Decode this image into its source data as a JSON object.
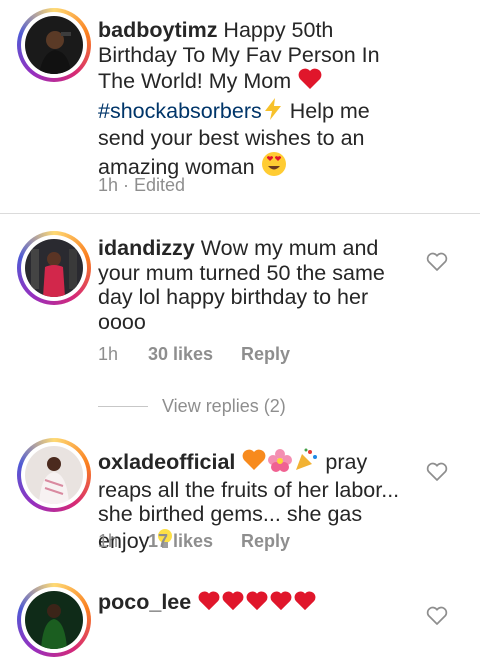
{
  "caption": {
    "username": "badboytimz",
    "text_1": " Happy 50th Birthday To My Fav Person In The World! My Mom ",
    "hashtag": "#shockabsorbers",
    "text_2": " Help me send your best wishes to an amazing woman ",
    "time": "1h",
    "separator": " · ",
    "edited": "Edited"
  },
  "comments": [
    {
      "username": "idandizzy",
      "text": " Wow my mum and your mum turned 50 the same day lol happy birthday to her oooo",
      "time": "1h",
      "likes": "30 likes",
      "reply": "Reply",
      "view_replies": "View replies (2)"
    },
    {
      "username": "oxladeofficial",
      "text": " pray reaps all the fruits of her labor... she birthed gems... she gas enjoy ",
      "time": "1h",
      "likes": "17 likes",
      "reply": "Reply"
    },
    {
      "username": "poco_lee",
      "text": ""
    }
  ],
  "colors": {
    "hashtag": "#003569",
    "meta": "#8e8e8e",
    "heart_emoji": "#e0162b"
  }
}
